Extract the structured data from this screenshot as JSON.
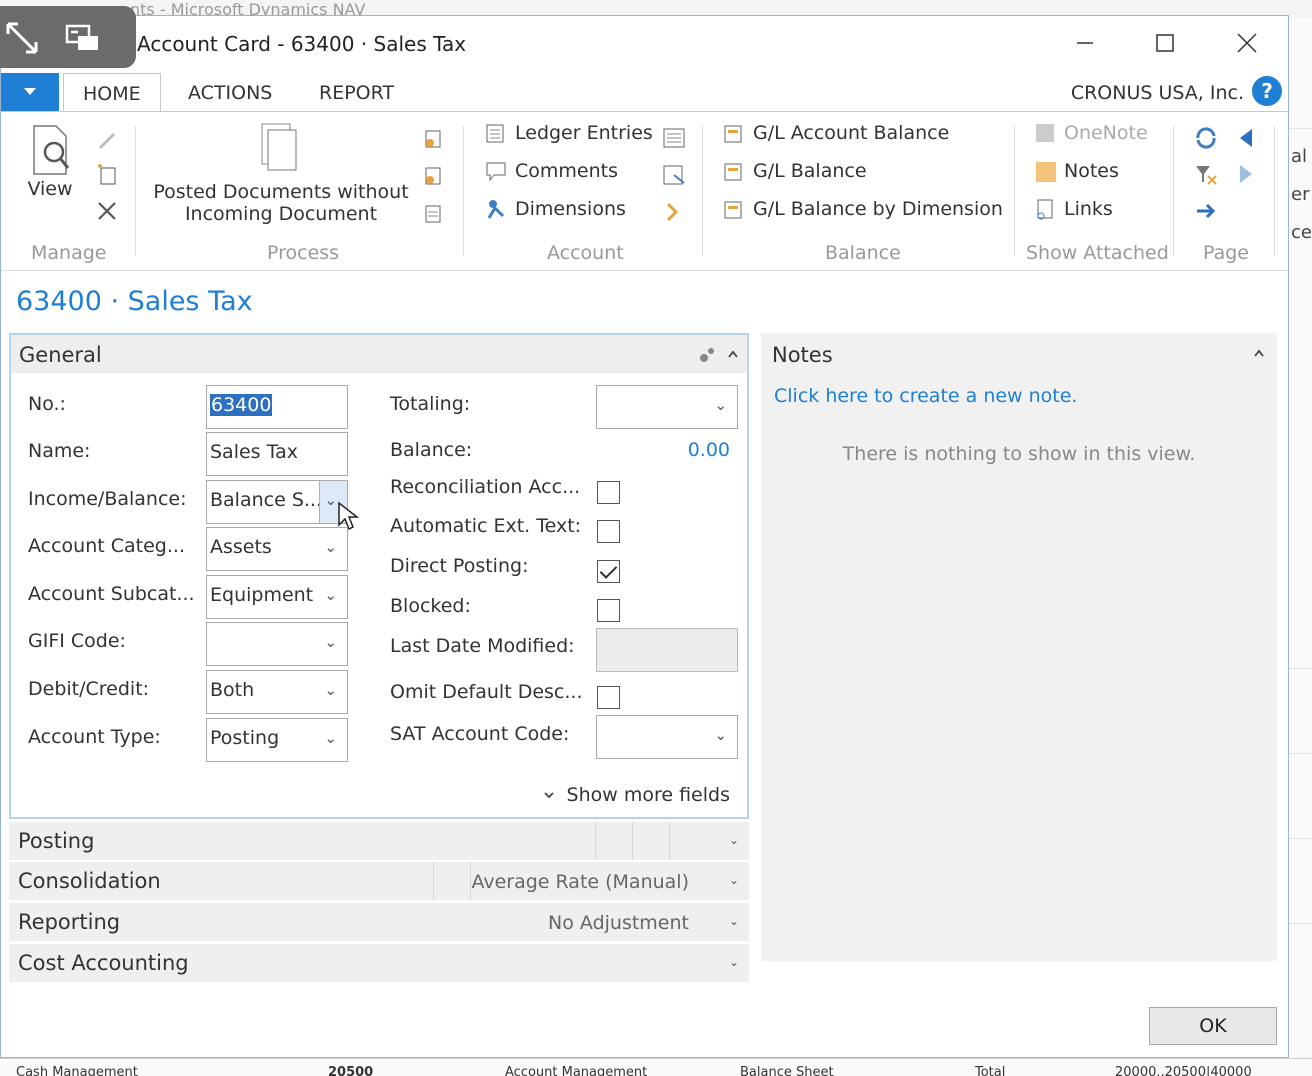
{
  "background": {
    "title_fragment": "nts - Microsoft Dynamics NAV",
    "right_fragments": [
      "al",
      "er",
      "ce"
    ],
    "bottom_fragments": [
      "Cash Management",
      "20500",
      "Account Management",
      "Balance Sheet",
      "Total",
      "20000..20500|40000"
    ]
  },
  "window": {
    "title": "Account Card - 63400 · Sales Tax",
    "minimize": "–",
    "maximize": "□",
    "close": "✕"
  },
  "ribbon": {
    "tabs": [
      "HOME",
      "ACTIONS",
      "REPORT"
    ],
    "company": "CRONUS USA, Inc.",
    "help": "?",
    "groups": {
      "manage": {
        "label": "Manage",
        "view": "View"
      },
      "process": {
        "label": "Process",
        "posted_docs_line1": "Posted Documents without",
        "posted_docs_line2": "Incoming Document"
      },
      "account": {
        "label": "Account",
        "items": [
          "Ledger Entries",
          "Comments",
          "Dimensions"
        ]
      },
      "balance": {
        "label": "Balance",
        "items": [
          "G/L Account Balance",
          "G/L Balance",
          "G/L Balance by Dimension"
        ]
      },
      "show_attached": {
        "label": "Show Attached",
        "items": [
          "OneNote",
          "Notes",
          "Links"
        ]
      },
      "page": {
        "label": "Page"
      }
    }
  },
  "page_title": "63400 · Sales Tax",
  "general": {
    "title": "General",
    "left": [
      {
        "label": "No.:",
        "value": "63400"
      },
      {
        "label": "Name:",
        "value": "Sales Tax"
      },
      {
        "label": "Income/Balance:",
        "value": "Balance S..."
      },
      {
        "label": "Account Categ...",
        "value": "Assets"
      },
      {
        "label": "Account Subcat...",
        "value": "Equipment"
      },
      {
        "label": "GIFI Code:",
        "value": ""
      },
      {
        "label": "Debit/Credit:",
        "value": "Both"
      },
      {
        "label": "Account Type:",
        "value": "Posting"
      }
    ],
    "right": {
      "totaling_label": "Totaling:",
      "balance_label": "Balance:",
      "balance_value": "0.00",
      "reconciliation_label": "Reconciliation Acc...",
      "automatic_label": "Automatic Ext. Text:",
      "direct_posting_label": "Direct Posting:",
      "blocked_label": "Blocked:",
      "last_date_label": "Last Date Modified:",
      "omit_label": "Omit Default Desc...",
      "sat_label": "SAT Account Code:"
    },
    "checkboxes": {
      "reconciliation": false,
      "automatic": false,
      "direct_posting": true,
      "blocked": false,
      "omit": false
    },
    "show_more": "Show more fields"
  },
  "fasttabs": [
    {
      "title": "Posting",
      "value": ""
    },
    {
      "title": "Consolidation",
      "value": "Average Rate (Manual)"
    },
    {
      "title": "Reporting",
      "value": "No Adjustment"
    },
    {
      "title": "Cost Accounting",
      "value": ""
    }
  ],
  "notes": {
    "title": "Notes",
    "link": "Click here to create a new note.",
    "empty": "There is nothing to show in this view."
  },
  "ok_label": "OK"
}
